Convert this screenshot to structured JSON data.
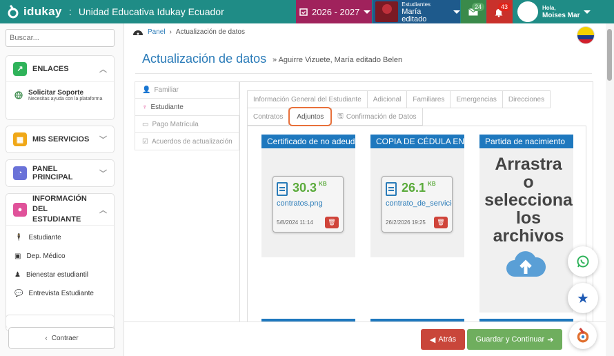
{
  "topbar": {
    "brand": "idukay",
    "separator": ":",
    "school": "Unidad Educativa Idukay Ecuador",
    "year": "2026 - 2027",
    "student_label": "Estudiantes",
    "student_name": "María editado",
    "mail_count": "24",
    "bell_count": "43",
    "greeting": "Hola,",
    "user_name": "Moises Mar",
    "colors": {
      "bar": "#1f8c86",
      "year": "#a0225c",
      "student": "#1e5a8c",
      "mail": "#3a8a4a",
      "bell": "#c9312b"
    }
  },
  "sidebar": {
    "search_placeholder": "Buscar...",
    "enlaces": {
      "title": "ENLACES",
      "icon": "external-link-icon",
      "color": "#2fb35a",
      "item_title": "Solicitar Soporte",
      "item_sub": "Necesitas ayuda con la plataforma"
    },
    "mis_servicios": {
      "title": "MIS SERVICIOS",
      "icon": "grid-icon",
      "color": "#f0a818"
    },
    "panel_principal": {
      "title": "PANEL PRINCIPAL",
      "icon": "dashboard-icon",
      "color": "#6a72d8"
    },
    "info_estudiante": {
      "title_1": "INFORMACIÓN DEL",
      "title_2": "ESTUDIANTE",
      "icon": "user-icon",
      "color": "#e0529a",
      "items": [
        {
          "label": "Estudiante",
          "icon": "person-icon"
        },
        {
          "label": "Dep. Médico",
          "icon": "medkit-icon"
        },
        {
          "label": "Bienestar estudiantil",
          "icon": "user-tie-icon"
        },
        {
          "label": "Entrevista Estudiante",
          "icon": "chat-icon"
        }
      ]
    },
    "collapse_label": "Contraer"
  },
  "breadcrumb": {
    "home": "Panel",
    "current": "Actualización de datos"
  },
  "page": {
    "title": "Actualización de datos",
    "subtitle": "» Aguirre Vizuete, María editado Belen"
  },
  "left_tabs": [
    {
      "label": "Familiar",
      "icon": "user-icon"
    },
    {
      "label": "Estudiante",
      "icon": "female-icon"
    },
    {
      "label": "Pago Matrícula",
      "icon": "money-icon"
    },
    {
      "label": "Acuerdos de actualización",
      "icon": "check-square-icon"
    }
  ],
  "tabs_row1": [
    "Información General del Estudiante",
    "Adicional",
    "Familiares",
    "Emergencias",
    "Direcciones"
  ],
  "tabs_row2": [
    "Contratos",
    "Adjuntos",
    "Confirmación de Datos"
  ],
  "documents": [
    {
      "title": "Certificado de no adeudar",
      "size": "30.3",
      "unit": "KB",
      "file": "contratos.png",
      "date": "5/8/2024 11:14"
    },
    {
      "title": "COPIA DE CÉDULA ENMARCADA",
      "size": "26.1",
      "unit": "KB",
      "file": "contrato_de_servicios",
      "date": "26/2/2026 19:25"
    },
    {
      "title": "Partida de nacimiento",
      "drop_1": "Arrastra",
      "drop_2": "o",
      "drop_3": "selecciona",
      "drop_4": "los",
      "drop_5": "archivos"
    }
  ],
  "footer": {
    "back": "Atrás",
    "save": "Guardar y Continuar"
  },
  "fabs": [
    "whatsapp-icon",
    "star-icon",
    "idukay-logo-icon"
  ]
}
